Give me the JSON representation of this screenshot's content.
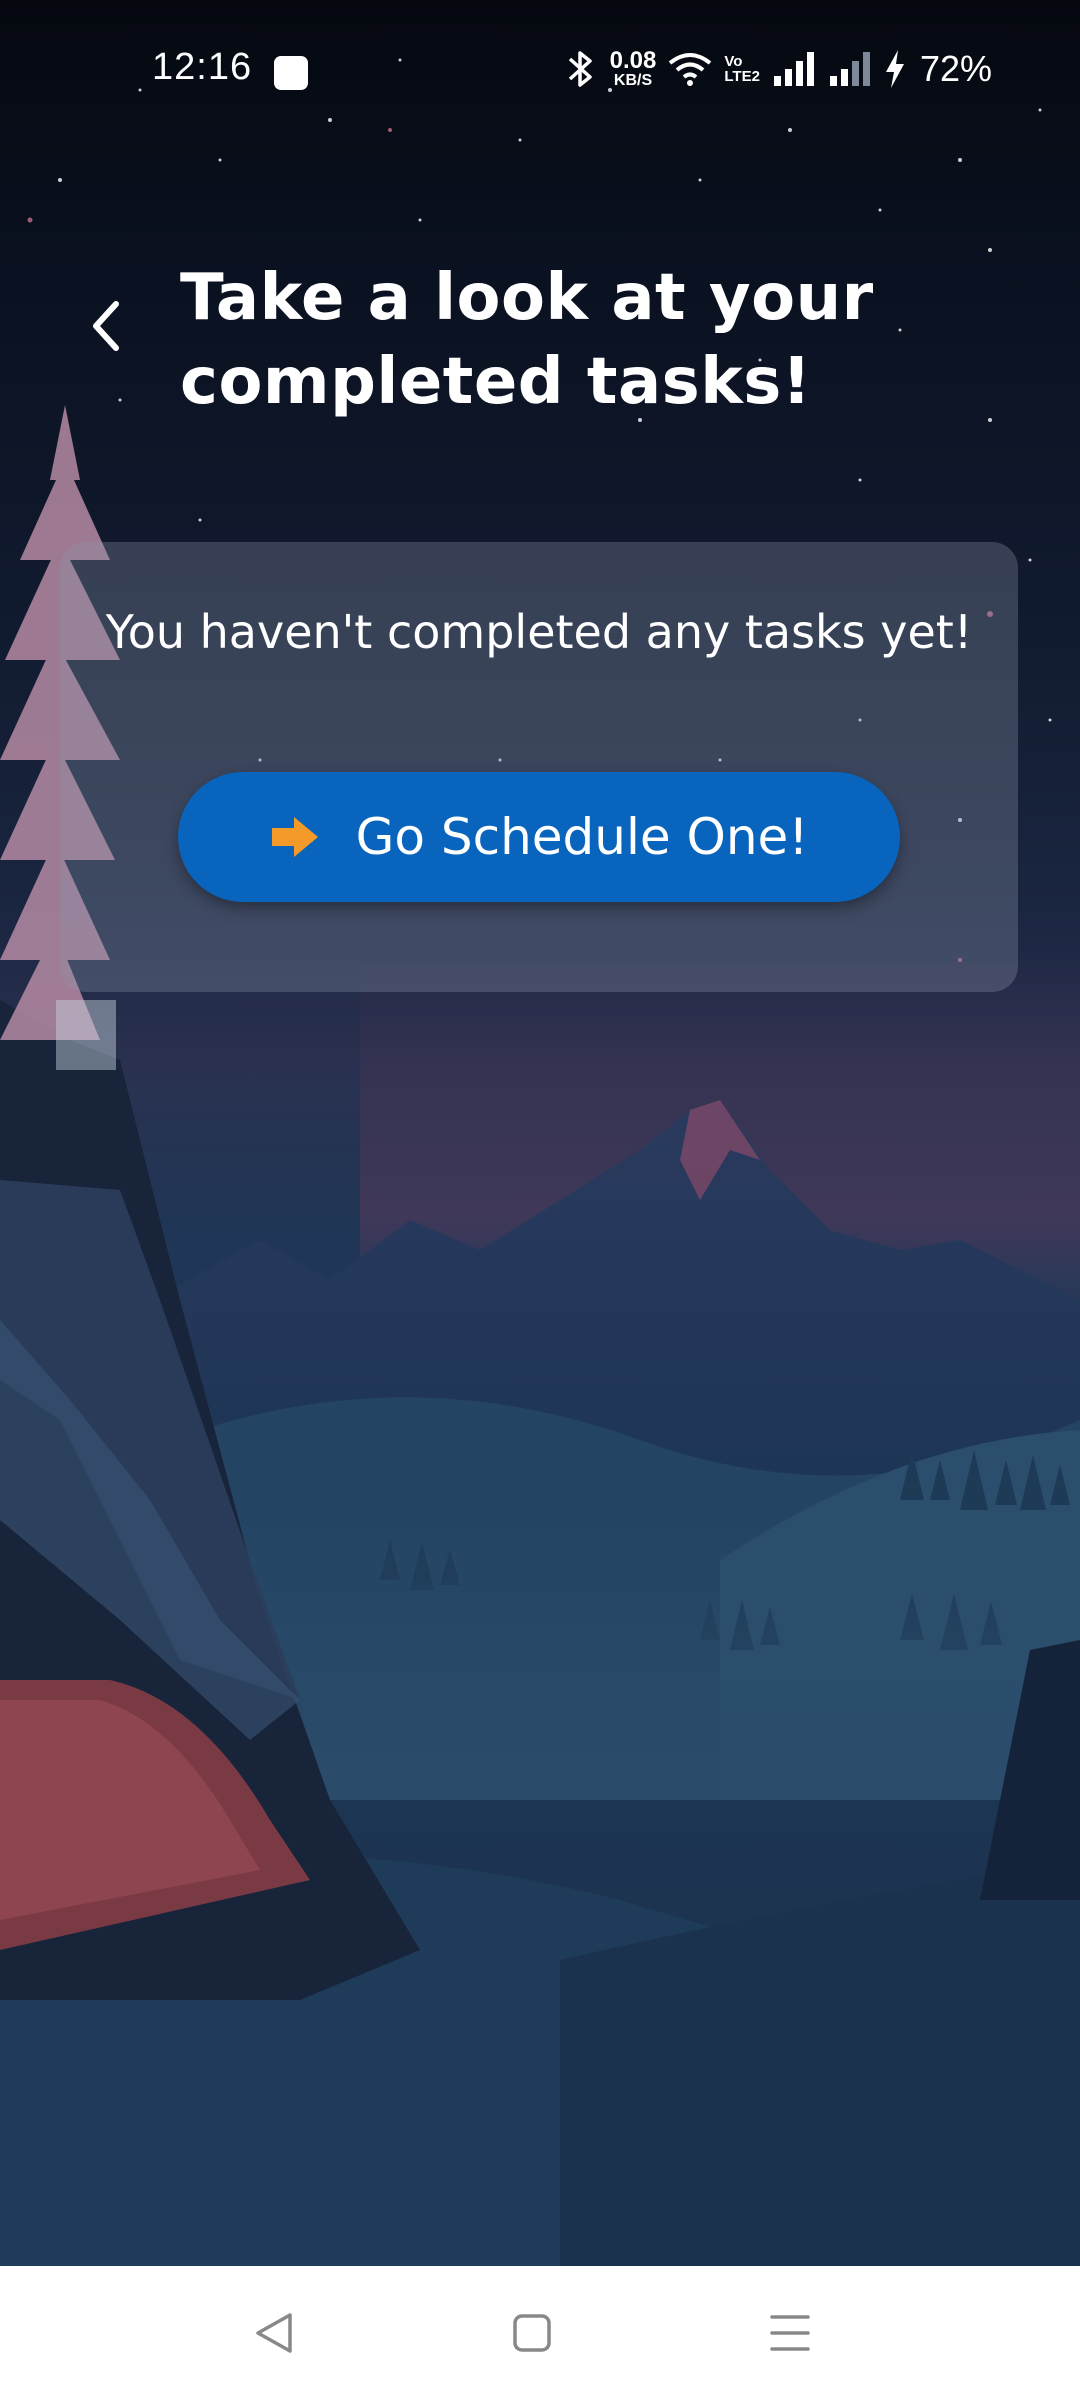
{
  "status_bar": {
    "time": "12:16",
    "net_speed_value": "0.08",
    "net_speed_unit": "KB/S",
    "volte_top": "Vo",
    "volte_bottom": "LTE2",
    "battery": "72%"
  },
  "header": {
    "title": "Take a look at your completed tasks!"
  },
  "card": {
    "message": "You haven't completed any tasks yet!",
    "button_label": "Go Schedule One!"
  },
  "colors": {
    "button": "#0864bd",
    "arrow": "#f39a2a",
    "card": "rgba(140,150,170,0.32)"
  },
  "icons": [
    "back-icon",
    "arrow-right-icon",
    "nav-back-icon",
    "nav-home-icon",
    "nav-recents-icon"
  ]
}
